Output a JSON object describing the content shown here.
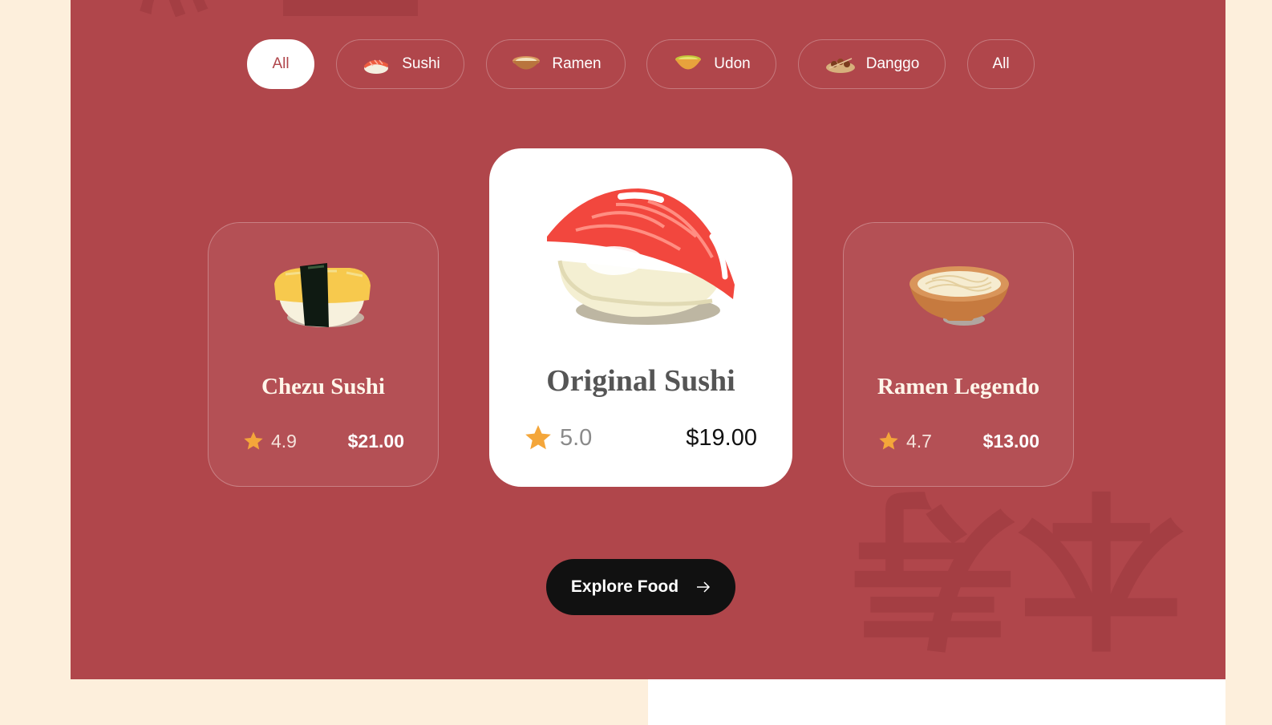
{
  "tabs": [
    {
      "label": "All",
      "icon": "",
      "active": true
    },
    {
      "label": "Sushi",
      "icon": "sushi-icon",
      "active": false
    },
    {
      "label": "Ramen",
      "icon": "ramen-bowl-icon",
      "active": false
    },
    {
      "label": "Udon",
      "icon": "udon-bowl-icon",
      "active": false
    },
    {
      "label": "Danggo",
      "icon": "dango-skewer-icon",
      "active": false
    },
    {
      "label": "All",
      "icon": "",
      "active": false
    }
  ],
  "cards": {
    "left": {
      "title": "Chezu Sushi",
      "rating": "4.9",
      "price": "$21.00"
    },
    "featured": {
      "title": "Original Sushi",
      "rating": "5.0",
      "price": "$19.00"
    },
    "right": {
      "title": "Ramen Legendo",
      "rating": "4.7",
      "price": "$13.00"
    }
  },
  "cta": {
    "label": "Explore Food"
  },
  "colors": {
    "section_bg": "#b0464b",
    "page_bg": "#fdefdc",
    "star": "#f4a63a",
    "cta_bg": "#111111"
  }
}
